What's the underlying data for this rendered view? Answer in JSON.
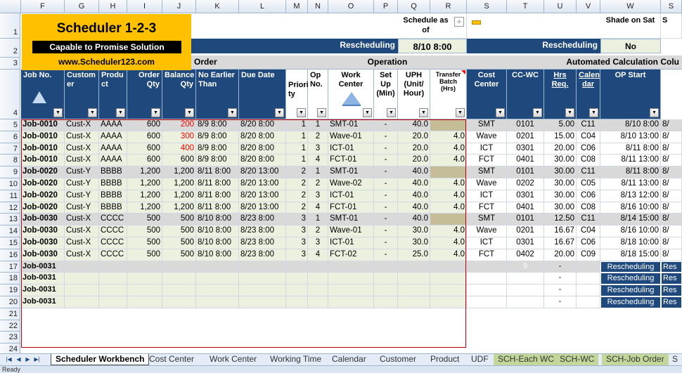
{
  "col_headers": [
    "F",
    "G",
    "H",
    "I",
    "J",
    "K",
    "L",
    "M",
    "N",
    "O",
    "P",
    "Q",
    "R",
    "S",
    "T",
    "U",
    "V",
    "W",
    "S"
  ],
  "row_numbers": [
    "1",
    "2",
    "3",
    "4",
    "5",
    "6",
    "7",
    "8",
    "9",
    "10",
    "11",
    "12",
    "13",
    "14",
    "15",
    "16",
    "17",
    "18",
    "19",
    "20",
    "21",
    "22",
    "23",
    "24"
  ],
  "logo": {
    "title": "Scheduler 1-2-3",
    "subtitle": "Capable to Promise Solution",
    "url": "www.Scheduler123.com"
  },
  "top": {
    "schedule_as_of": "Schedule as of",
    "schedule_value": "8/10 8:00",
    "rescheduling_1": "Rescheduling",
    "rescheduling_2": "Rescheduling",
    "shade_on_sat": "Shade on Sat",
    "shade_value": "No",
    "order_band": "Order",
    "operation_band": "Operation",
    "auto_band": "Automated Calculation Colu",
    "cut_col": "S"
  },
  "headers": {
    "job_no": "Job No.",
    "customer": "Custom er",
    "product": "Produ ct",
    "order_qty": "Order Qty",
    "balance_qty": "Balance Qty",
    "no_earlier": "No Earlier Than",
    "due_date": "Due Date",
    "priority": "Priori ty",
    "op_no": "Op No.",
    "work_center": "Work Center",
    "setup": "Set Up (Min)",
    "uph": "UPH (Unit/ Hour)",
    "transfer": "Transfer Batch (Hrs)",
    "cost_center": "Cost Center",
    "cc_wc": "CC-WC",
    "hrs_req": "Hrs Req.",
    "calendar": "Calen dar",
    "op_start": "OP Start"
  },
  "rows": [
    {
      "job": "Job-0010",
      "cust": "Cust-X",
      "prod": "AAAA",
      "oqty": "600",
      "bqty": "200",
      "net": "8/9 8:00",
      "due": "8/20 8:00",
      "pri": "1",
      "op": "1",
      "wc": "SMT-01",
      "setup": "-",
      "uph": "40.0",
      "tb": "",
      "cc": "SMT",
      "ccwc": "0101",
      "hrs": "5.00",
      "cal": "C11",
      "start": "8/10 8:00",
      "w": "8/",
      "red": true,
      "first": true
    },
    {
      "job": "Job-0010",
      "cust": "Cust-X",
      "prod": "AAAA",
      "oqty": "600",
      "bqty": "300",
      "net": "8/9 8:00",
      "due": "8/20 8:00",
      "pri": "1",
      "op": "2",
      "wc": "Wave-01",
      "setup": "-",
      "uph": "20.0",
      "tb": "4.0",
      "cc": "Wave",
      "ccwc": "0201",
      "hrs": "15.00",
      "cal": "C04",
      "start": "8/10 13:00",
      "w": "8/",
      "red": true
    },
    {
      "job": "Job-0010",
      "cust": "Cust-X",
      "prod": "AAAA",
      "oqty": "600",
      "bqty": "400",
      "net": "8/9 8:00",
      "due": "8/20 8:00",
      "pri": "1",
      "op": "3",
      "wc": "ICT-01",
      "setup": "-",
      "uph": "20.0",
      "tb": "4.0",
      "cc": "ICT",
      "ccwc": "0301",
      "hrs": "20.00",
      "cal": "C06",
      "start": "8/11 8:00",
      "w": "8/",
      "red": true
    },
    {
      "job": "Job-0010",
      "cust": "Cust-X",
      "prod": "AAAA",
      "oqty": "600",
      "bqty": "600",
      "net": "8/9 8:00",
      "due": "8/20 8:00",
      "pri": "1",
      "op": "4",
      "wc": "FCT-01",
      "setup": "-",
      "uph": "20.0",
      "tb": "4.0",
      "cc": "FCT",
      "ccwc": "0401",
      "hrs": "30.00",
      "cal": "C08",
      "start": "8/11 13:00",
      "w": "8/"
    },
    {
      "job": "Job-0020",
      "cust": "Cust-Y",
      "prod": "BBBB",
      "oqty": "1,200",
      "bqty": "1,200",
      "net": "8/11 8:00",
      "due": "8/20 13:00",
      "pri": "2",
      "op": "1",
      "wc": "SMT-01",
      "setup": "-",
      "uph": "40.0",
      "tb": "",
      "cc": "SMT",
      "ccwc": "0101",
      "hrs": "30.00",
      "cal": "C11",
      "start": "8/11 8:00",
      "w": "8/",
      "first": true
    },
    {
      "job": "Job-0020",
      "cust": "Cust-Y",
      "prod": "BBBB",
      "oqty": "1,200",
      "bqty": "1,200",
      "net": "8/11 8:00",
      "due": "8/20 13:00",
      "pri": "2",
      "op": "2",
      "wc": "Wave-02",
      "setup": "-",
      "uph": "40.0",
      "tb": "4.0",
      "cc": "Wave",
      "ccwc": "0202",
      "hrs": "30.00",
      "cal": "C05",
      "start": "8/11 13:00",
      "w": "8/"
    },
    {
      "job": "Job-0020",
      "cust": "Cust-Y",
      "prod": "BBBB",
      "oqty": "1,200",
      "bqty": "1,200",
      "net": "8/11 8:00",
      "due": "8/20 13:00",
      "pri": "2",
      "op": "3",
      "wc": "ICT-01",
      "setup": "-",
      "uph": "40.0",
      "tb": "4.0",
      "cc": "ICT",
      "ccwc": "0301",
      "hrs": "30.00",
      "cal": "C06",
      "start": "8/13 12:00",
      "w": "8/"
    },
    {
      "job": "Job-0020",
      "cust": "Cust-Y",
      "prod": "BBBB",
      "oqty": "1,200",
      "bqty": "1,200",
      "net": "8/11 8:00",
      "due": "8/20 13:00",
      "pri": "2",
      "op": "4",
      "wc": "FCT-01",
      "setup": "-",
      "uph": "40.0",
      "tb": "4.0",
      "cc": "FCT",
      "ccwc": "0401",
      "hrs": "30.00",
      "cal": "C08",
      "start": "8/16 10:00",
      "w": "8/"
    },
    {
      "job": "Job-0030",
      "cust": "Cust-X",
      "prod": "CCCC",
      "oqty": "500",
      "bqty": "500",
      "net": "8/10 8:00",
      "due": "8/23 8:00",
      "pri": "3",
      "op": "1",
      "wc": "SMT-01",
      "setup": "-",
      "uph": "40.0",
      "tb": "",
      "cc": "SMT",
      "ccwc": "0101",
      "hrs": "12.50",
      "cal": "C11",
      "start": "8/14 15:00",
      "w": "8/",
      "first": true
    },
    {
      "job": "Job-0030",
      "cust": "Cust-X",
      "prod": "CCCC",
      "oqty": "500",
      "bqty": "500",
      "net": "8/10 8:00",
      "due": "8/23 8:00",
      "pri": "3",
      "op": "2",
      "wc": "Wave-01",
      "setup": "-",
      "uph": "30.0",
      "tb": "4.0",
      "cc": "Wave",
      "ccwc": "0201",
      "hrs": "16.67",
      "cal": "C04",
      "start": "8/16 10:00",
      "w": "8/"
    },
    {
      "job": "Job-0030",
      "cust": "Cust-X",
      "prod": "CCCC",
      "oqty": "500",
      "bqty": "500",
      "net": "8/10 8:00",
      "due": "8/23 8:00",
      "pri": "3",
      "op": "3",
      "wc": "ICT-01",
      "setup": "-",
      "uph": "30.0",
      "tb": "4.0",
      "cc": "ICT",
      "ccwc": "0301",
      "hrs": "16.67",
      "cal": "C06",
      "start": "8/18 10:00",
      "w": "8/"
    },
    {
      "job": "Job-0030",
      "cust": "Cust-X",
      "prod": "CCCC",
      "oqty": "500",
      "bqty": "500",
      "net": "8/10 8:00",
      "due": "8/23 8:00",
      "pri": "3",
      "op": "4",
      "wc": "FCT-02",
      "setup": "-",
      "uph": "25.0",
      "tb": "4.0",
      "cc": "FCT",
      "ccwc": "0402",
      "hrs": "20.00",
      "cal": "C09",
      "start": "8/18 15:00",
      "w": "8/"
    }
  ],
  "empty_rows": [
    {
      "job": "Job-0031",
      "tval": "9",
      "hrs": "-",
      "btn": "Rescheduling",
      "btn2": "Res",
      "grey": true
    },
    {
      "job": "Job-0031",
      "tval": "",
      "hrs": "-",
      "btn": "Rescheduling",
      "btn2": "Res"
    },
    {
      "job": "Job-0031",
      "tval": "",
      "hrs": "-",
      "btn": "Rescheduling",
      "btn2": "Res"
    },
    {
      "job": "Job-0031",
      "tval": "",
      "hrs": "-",
      "btn": "Rescheduling",
      "btn2": "Res"
    }
  ],
  "tabs": [
    "Scheduler Workbench",
    "Cost Center",
    "Work Center",
    "Working Time",
    "Calendar",
    "Customer",
    "Product",
    "UDF",
    "SCH-Each WC",
    "SCH-WC",
    "SCH-Job Order",
    "S"
  ],
  "status": "Ready",
  "colors": {
    "navy": "#1f497d",
    "gold": "#ffc000",
    "green": "#ebf1de",
    "grey": "#d9d9d9",
    "tan": "#c4bd97",
    "red": "#ff0000"
  }
}
